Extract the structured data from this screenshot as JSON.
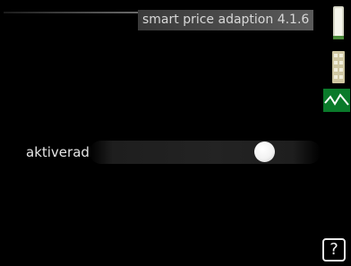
{
  "header": {
    "title": "smart price adaption 4.1.6"
  },
  "sidebar": {
    "icons": [
      "hot-water-icon",
      "heating-icon",
      "status-curve-icon"
    ]
  },
  "setting": {
    "label": "aktiverad",
    "enabled": true
  },
  "help": {
    "label": "?"
  },
  "colors": {
    "background": "#000000",
    "accent_green": "#0a8a2a",
    "text": "#e6e6e6"
  }
}
